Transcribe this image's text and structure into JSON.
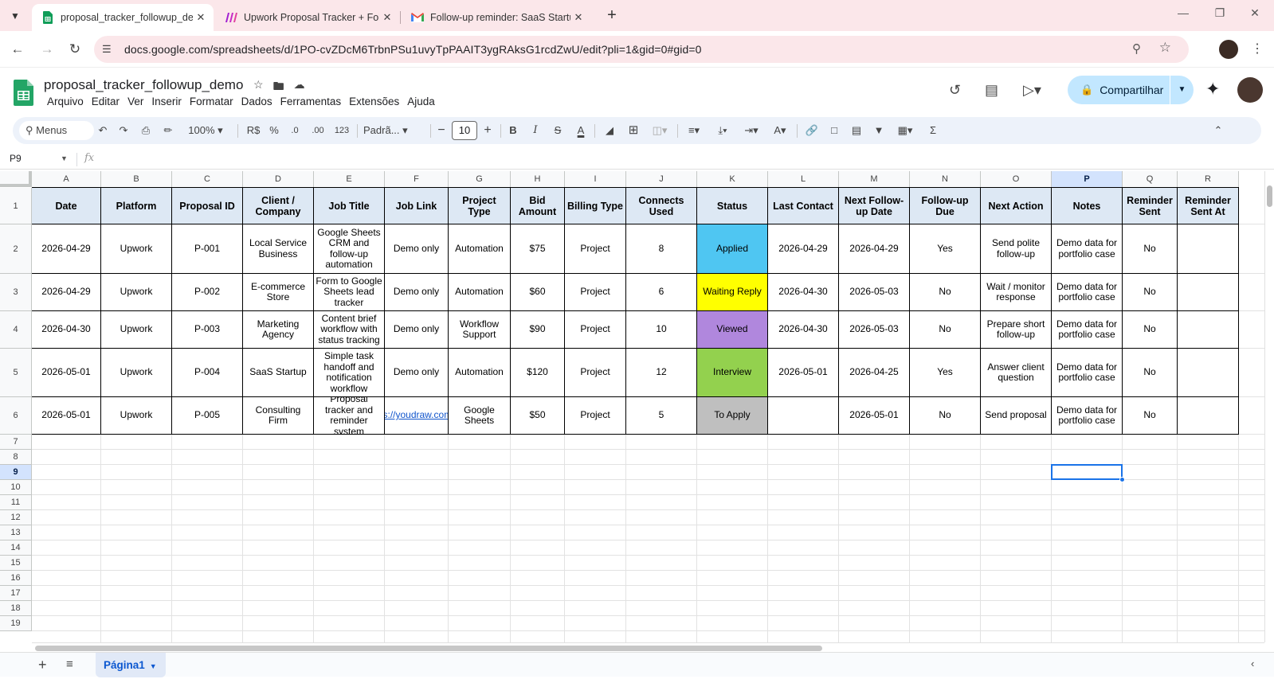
{
  "browser": {
    "tabs": [
      {
        "title": "proposal_tracker_followup_demo",
        "icon": "sheets-icon",
        "active": true
      },
      {
        "title": "Upwork Proposal Tracker + Follow-up",
        "icon": "make-icon",
        "active": false
      },
      {
        "title": "Follow-up reminder: SaaS Startup",
        "icon": "gmail-icon",
        "active": false
      }
    ],
    "url": "docs.google.com/spreadsheets/d/1PO-cvZDcM6TrbnPSu1uvyTpPAAIT3ygRAksG1rcdZwU/edit?pli=1&gid=0#gid=0"
  },
  "doc": {
    "title": "proposal_tracker_followup_demo",
    "menus": [
      "Arquivo",
      "Editar",
      "Ver",
      "Inserir",
      "Formatar",
      "Dados",
      "Ferramentas",
      "Extensões",
      "Ajuda"
    ],
    "share_label": "Compartilhar"
  },
  "toolbar": {
    "search_label": "Menus",
    "zoom": "100%",
    "currency": "R$",
    "percent": "%",
    "dec_decrease": ".0",
    "dec_increase": ".00",
    "number_format": "123",
    "font": "Padrã...",
    "font_size": "10"
  },
  "formula": {
    "cell_ref": "P9",
    "fx": "fx",
    "content": ""
  },
  "grid": {
    "columns": [
      "A",
      "B",
      "C",
      "D",
      "E",
      "F",
      "G",
      "H",
      "I",
      "J",
      "K",
      "L",
      "M",
      "N",
      "O",
      "P",
      "Q",
      "R"
    ],
    "selected_column": "P",
    "rows": [
      "1",
      "2",
      "3",
      "4",
      "5",
      "6",
      "7",
      "8",
      "9",
      "10",
      "11",
      "12",
      "13",
      "14",
      "15",
      "16",
      "17",
      "18",
      "19"
    ],
    "selected_row": "9",
    "selected_cell": "P9",
    "headers": [
      "Date",
      "Platform",
      "Proposal ID",
      "Client / Company",
      "Job Title",
      "Job Link",
      "Project Type",
      "Bid Amount",
      "Billing Type",
      "Connects Used",
      "Status",
      "Last Contact",
      "Next Follow-up Date",
      "Follow-up Due",
      "Next Action",
      "Notes",
      "Reminder Sent",
      "Reminder Sent At"
    ],
    "data": [
      [
        "2026-04-29",
        "Upwork",
        "P-001",
        "Local Service Business",
        "Google Sheets CRM and follow-up automation",
        "Demo only",
        "Automation",
        "$75",
        "Project",
        "8",
        "Applied",
        "2026-04-29",
        "2026-04-29",
        "Yes",
        "Send polite follow-up",
        "Demo data for portfolio case",
        "No",
        ""
      ],
      [
        "2026-04-29",
        "Upwork",
        "P-002",
        "E-commerce Store",
        "Form to Google Sheets lead tracker",
        "Demo only",
        "Automation",
        "$60",
        "Project",
        "6",
        "Waiting Reply",
        "2026-04-30",
        "2026-05-03",
        "No",
        "Wait / monitor response",
        "Demo data for portfolio case",
        "No",
        ""
      ],
      [
        "2026-04-30",
        "Upwork",
        "P-003",
        "Marketing Agency",
        "Content brief workflow with status tracking",
        "Demo only",
        "Workflow Support",
        "$90",
        "Project",
        "10",
        "Viewed",
        "2026-04-30",
        "2026-05-03",
        "No",
        "Prepare short follow-up",
        "Demo data for portfolio case",
        "No",
        ""
      ],
      [
        "2026-05-01",
        "Upwork",
        "P-004",
        "SaaS Startup",
        "Simple task handoff and notification workflow",
        "Demo only",
        "Automation",
        "$120",
        "Project",
        "12",
        "Interview",
        "2026-05-01",
        "2026-04-25",
        "Yes",
        "Answer client question",
        "Demo data for portfolio case",
        "No",
        ""
      ],
      [
        "2026-05-01",
        "Upwork",
        "P-005",
        "Consulting Firm",
        "Proposal tracker and reminder system",
        "https://youdraw.com.br/",
        "Google Sheets",
        "$50",
        "Project",
        "5",
        "To Apply",
        "",
        "2026-05-01",
        "No",
        "Send proposal",
        "Demo data for portfolio case",
        "No",
        ""
      ]
    ],
    "status_colors": {
      "Applied": "#4fc6f2",
      "Waiting Reply": "#ffff00",
      "Viewed": "#b087dd",
      "Interview": "#93d14e",
      "To Apply": "#bfbfbf"
    },
    "header_fill": "#dde8f4"
  },
  "sheets": [
    {
      "name": "Página1",
      "active": true
    }
  ],
  "accent": "#1a73e8"
}
